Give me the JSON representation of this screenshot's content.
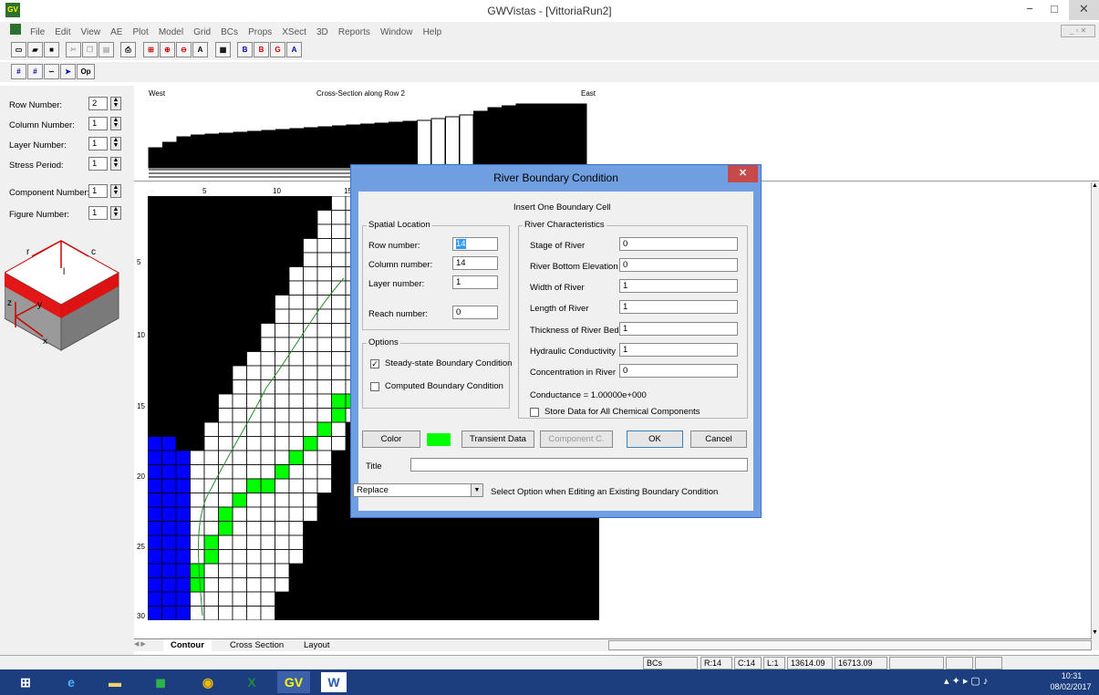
{
  "window": {
    "app_icon_glyph": "GV",
    "title": "GWVistas - [VittoriaRun2]",
    "min_glyph": "−",
    "max_glyph": "□",
    "close_glyph": "✕"
  },
  "menu": [
    "File",
    "Edit",
    "View",
    "AE",
    "Plot",
    "Model",
    "Grid",
    "BCs",
    "Props",
    "XSect",
    "3D",
    "Reports",
    "Window",
    "Help"
  ],
  "toolbar2": {
    "op_label": "Op"
  },
  "left_panel": {
    "fields": [
      {
        "label": "Row Number:",
        "value": "2"
      },
      {
        "label": "Column Number:",
        "value": "1"
      },
      {
        "label": "Layer Number:",
        "value": "1"
      },
      {
        "label": "Stress Period:",
        "value": "1"
      },
      {
        "label": "Component Number:",
        "value": "1"
      },
      {
        "label": "Figure Number:",
        "value": "1"
      }
    ],
    "axes": {
      "r": "r",
      "c": "c",
      "l": "l",
      "z": "z",
      "y": "y",
      "x": "x"
    }
  },
  "cross_section": {
    "title": "Cross-Section along Row  2",
    "west": "West",
    "east": "East"
  },
  "map": {
    "col_ticks": [
      "5",
      "10",
      "15"
    ],
    "row_ticks": [
      "5",
      "10",
      "15",
      "20",
      "25",
      "30"
    ]
  },
  "tabs": [
    "Contour",
    "Cross Section",
    "Layout"
  ],
  "status": {
    "bcs": "BCs",
    "row": "R:14",
    "col": "C:14",
    "lay": "L:1",
    "x": "13614.09",
    "y": "16713.09"
  },
  "taskbar": {
    "time": "10:31",
    "date": "08/02/2017"
  },
  "dialog": {
    "title": "River Boundary Condition",
    "close_glyph": "✕",
    "header": "Insert One Boundary Cell",
    "spatial": {
      "legend": "Spatial Location",
      "row_label": "Row number:",
      "row_value": "14",
      "col_label": "Column number:",
      "col_value": "14",
      "layer_label": "Layer number:",
      "layer_value": "1",
      "reach_label": "Reach number:",
      "reach_value": "0"
    },
    "river": {
      "legend": "River Characteristics",
      "fields": [
        {
          "label": "Stage of River",
          "value": "0"
        },
        {
          "label": "River Bottom Elevation",
          "value": "0"
        },
        {
          "label": "Width of River",
          "value": "1"
        },
        {
          "label": "Length of River",
          "value": "1"
        },
        {
          "label": "Thickness of River Bed",
          "value": "1"
        },
        {
          "label": "Hydraulic Conductivity",
          "value": "1"
        },
        {
          "label": "Concentration in River",
          "value": "0"
        }
      ],
      "conductance": "Conductance = 1.00000e+000",
      "store_all": "Store Data for All Chemical Components"
    },
    "options": {
      "legend": "Options",
      "steady": "Steady-state Boundary Condition",
      "steady_checked": true,
      "computed": "Computed Boundary Condition",
      "computed_checked": false
    },
    "buttons": {
      "color": "Color",
      "transient": "Transient Data",
      "component": "Component C.",
      "ok": "OK",
      "cancel": "Cancel"
    },
    "swatch_color": "#00ff00",
    "title_label": "Title",
    "title_value": "",
    "replace_value": "Replace",
    "replace_hint": "Select Option when Editing an Existing Boundary Condition"
  }
}
